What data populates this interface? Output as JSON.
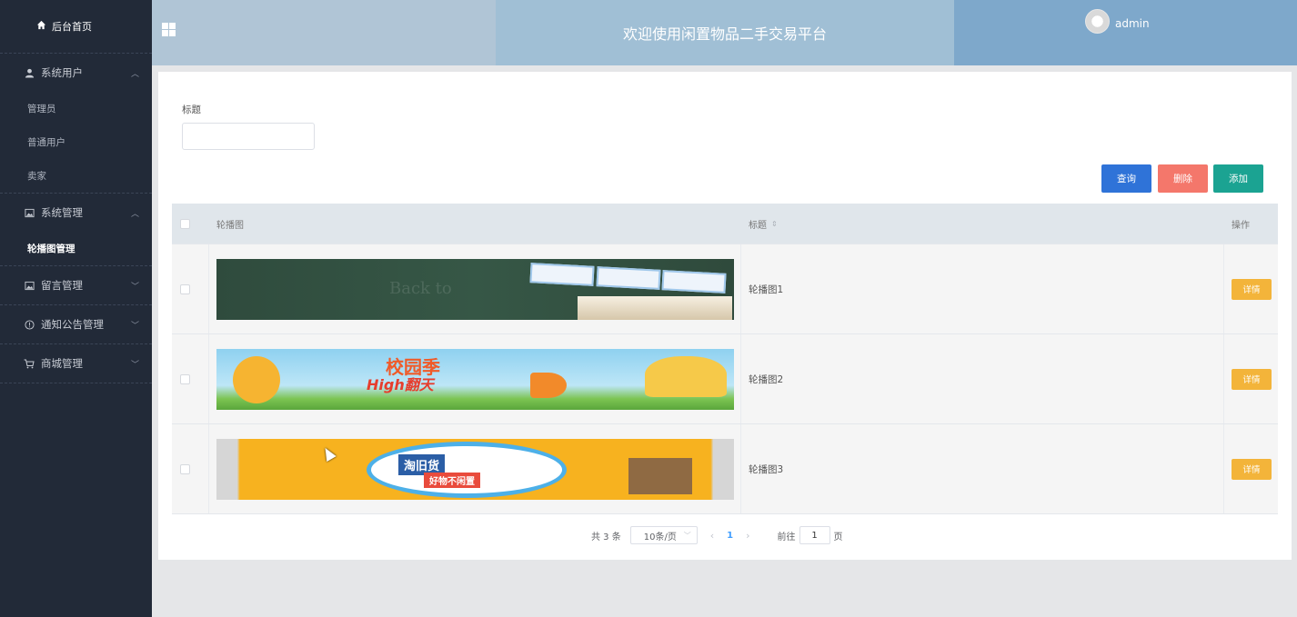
{
  "sidebar": {
    "home_label": "后台首页",
    "groups": [
      {
        "label": "系统用户",
        "items": [
          {
            "label": "管理员"
          },
          {
            "label": "普通用户"
          },
          {
            "label": "卖家"
          }
        ]
      },
      {
        "label": "系统管理",
        "items": [
          {
            "label": "轮播图管理"
          }
        ]
      },
      {
        "label": "留言管理",
        "items": []
      },
      {
        "label": "通知公告管理",
        "items": []
      },
      {
        "label": "商城管理",
        "items": []
      }
    ]
  },
  "header": {
    "title": "欢迎使用闲置物品二手交易平台",
    "username": "admin"
  },
  "filter": {
    "title_label": "标题",
    "title_value": ""
  },
  "toolbar": {
    "query_label": "查询",
    "delete_label": "删除",
    "add_label": "添加"
  },
  "table": {
    "columns": {
      "image": "轮播图",
      "title": "标题",
      "action": "操作"
    },
    "rows": [
      {
        "title": "轮播图1",
        "action": "详情",
        "banner_text": "Back to"
      },
      {
        "title": "轮播图2",
        "action": "详情",
        "banner_text": "校园季",
        "banner_text2": "High翻天"
      },
      {
        "title": "轮播图3",
        "action": "详情",
        "banner_text": "淘旧货",
        "banner_text2": "好物不闲置"
      }
    ]
  },
  "pagination": {
    "total": "共 3 条",
    "page_size": "10条/页",
    "current_page": "1",
    "goto_label": "前往",
    "goto_value": "1",
    "page_suffix": "页"
  },
  "colors": {
    "sidebar_bg": "#222a38",
    "query_btn": "#2f73d8",
    "delete_btn": "#f4776b",
    "add_btn": "#1ba392",
    "detail_btn": "#f3b43a"
  }
}
